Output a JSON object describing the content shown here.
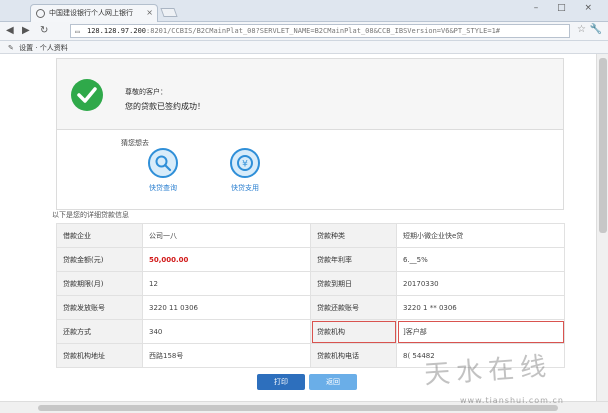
{
  "browser": {
    "tab_title": "中国建设银行个人网上银行",
    "tab_close": "×",
    "url_host": "128.128.97.200",
    "url_path": ":8201/CCBIS/B2CMainPlat_08?SERVLET_NAME=B2CMainPlat_08&CCB_IBSVersion=V6&PT_STYLE=1#",
    "window_controls": "– □ ×",
    "bookmarks_label": "设置 · 个人资料"
  },
  "success": {
    "greeting": "尊敬的客户：",
    "message": "您的贷款已签约成功！"
  },
  "guess": {
    "title": "猜您想去",
    "links": [
      {
        "label": "快贷查询",
        "icon": "search-icon"
      },
      {
        "label": "快贷支用",
        "icon": "money-icon"
      }
    ]
  },
  "detail": {
    "title": "以下是您的详细贷款信息",
    "rows": [
      [
        {
          "label": "借款企业",
          "value": "公司一八"
        },
        {
          "label": "贷款种类",
          "value": "短期小微企业快e贷"
        }
      ],
      [
        {
          "label": "贷款金额(元)",
          "value": "50,000.00"
        },
        {
          "label": "贷款年利率",
          "value": "6.__5%"
        }
      ],
      [
        {
          "label": "贷款期限(月)",
          "value": "12"
        },
        {
          "label": "贷款到期日",
          "value": "20170330"
        }
      ],
      [
        {
          "label": "贷款发放账号",
          "value": "3220 11              0306"
        },
        {
          "label": "贷款还款账号",
          "value": "3220 1   ** 0306"
        }
      ],
      [
        {
          "label": "还款方式",
          "value": "340"
        },
        {
          "label": "贷款机构",
          "value": "             ]客户部"
        }
      ],
      [
        {
          "label": "贷款机构地址",
          "value": "西路158号"
        },
        {
          "label": "贷款机构电话",
          "value": "8(            54482"
        }
      ]
    ]
  },
  "buttons": {
    "print": "打印",
    "back": "返回"
  },
  "watermark": {
    "text": "天水在线",
    "url": "www.tianshui.com.cn"
  },
  "colors": {
    "success_green": "#2fa94a",
    "amount_red": "#d21b1b",
    "link_blue": "#2a7fd0",
    "print_button": "#2d6fbd",
    "back_button": "#6aaee8"
  }
}
